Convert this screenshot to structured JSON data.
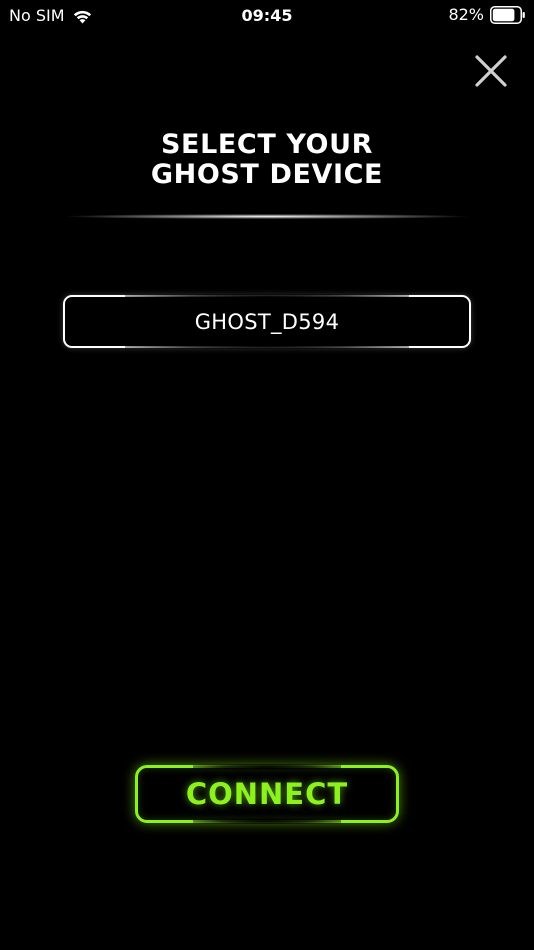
{
  "status_bar": {
    "carrier": "No SIM",
    "time": "09:45",
    "battery": "82%",
    "battery_level": 0.82,
    "icons": [
      "wifi-icon",
      "battery-icon"
    ]
  },
  "header": {
    "close_icon": "close-icon",
    "title_line1": "SELECT YOUR",
    "title_line2": "GHOST DEVICE"
  },
  "devices": [
    {
      "label": "GHOST_D594"
    }
  ],
  "actions": {
    "connect_label": "CONNECT"
  },
  "colors": {
    "background": "#000000",
    "text": "#ffffff",
    "accent": "#8cf21d"
  }
}
